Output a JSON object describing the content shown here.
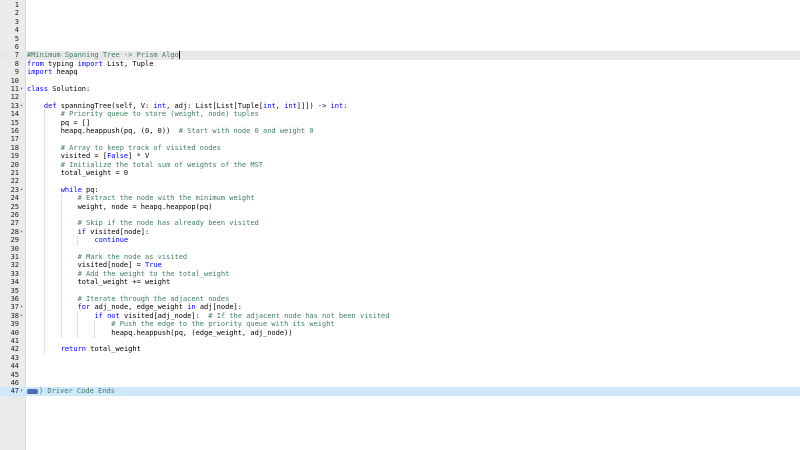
{
  "editor": {
    "lines": [
      {
        "n": "1",
        "text": ""
      },
      {
        "n": "2",
        "text": ""
      },
      {
        "n": "3",
        "text": ""
      },
      {
        "n": "4",
        "text": ""
      },
      {
        "n": "5",
        "text": ""
      },
      {
        "n": "6",
        "text": ""
      },
      {
        "n": "7",
        "text": "#Minimum Spanning Tree -> Prism Algo",
        "type": "comment",
        "active": true
      },
      {
        "n": "8",
        "text": "from typing import List, Tuple"
      },
      {
        "n": "9",
        "text": "import heapq"
      },
      {
        "n": "10",
        "text": ""
      },
      {
        "n": "11",
        "text": "class Solution:",
        "fold": true
      },
      {
        "n": "12",
        "text": ""
      },
      {
        "n": "13",
        "text": "    def spanningTree(self, V: int, adj: List[List[Tuple[int, int]]]) -> int:",
        "fold": true
      },
      {
        "n": "14",
        "text": "        # Priority queue to store (weight, node) tuples",
        "type": "comment"
      },
      {
        "n": "15",
        "text": "        pq = []"
      },
      {
        "n": "16",
        "text": "        heapq.heappush(pq, (0, 0))  # Start with node 0 and weight 0"
      },
      {
        "n": "17",
        "text": ""
      },
      {
        "n": "18",
        "text": "        # Array to keep track of visited nodes",
        "type": "comment"
      },
      {
        "n": "19",
        "text": "        visited = [False] * V"
      },
      {
        "n": "20",
        "text": "        # Initialize the total sum of weights of the MST",
        "type": "comment"
      },
      {
        "n": "21",
        "text": "        total_weight = 0"
      },
      {
        "n": "22",
        "text": ""
      },
      {
        "n": "23",
        "text": "        while pq:",
        "fold": true
      },
      {
        "n": "24",
        "text": "            # Extract the node with the minimum weight",
        "type": "comment"
      },
      {
        "n": "25",
        "text": "            weight, node = heapq.heappop(pq)"
      },
      {
        "n": "26",
        "text": ""
      },
      {
        "n": "27",
        "text": "            # Skip if the node has already been visited",
        "type": "comment"
      },
      {
        "n": "28",
        "text": "            if visited[node]:",
        "fold": true
      },
      {
        "n": "29",
        "text": "                continue"
      },
      {
        "n": "30",
        "text": ""
      },
      {
        "n": "31",
        "text": "            # Mark the node as visited",
        "type": "comment"
      },
      {
        "n": "32",
        "text": "            visited[node] = True"
      },
      {
        "n": "33",
        "text": "            # Add the weight to the total_weight",
        "type": "comment"
      },
      {
        "n": "34",
        "text": "            total_weight += weight"
      },
      {
        "n": "35",
        "text": ""
      },
      {
        "n": "36",
        "text": "            # Iterate through the adjacent nodes",
        "type": "comment"
      },
      {
        "n": "37",
        "text": "            for adj_node, edge_weight in adj[node]:",
        "fold": true
      },
      {
        "n": "38",
        "text": "                if not visited[adj_node]:  # If the adjacent node has not been visited",
        "fold": true
      },
      {
        "n": "39",
        "text": "                    # Push the edge to the priority queue with its weight",
        "type": "comment"
      },
      {
        "n": "40",
        "text": "                    heapq.heappush(pq, (edge_weight, adj_node))"
      },
      {
        "n": "41",
        "text": ""
      },
      {
        "n": "42",
        "text": "        return total_weight"
      },
      {
        "n": "43",
        "text": ""
      },
      {
        "n": "44",
        "text": ""
      },
      {
        "n": "45",
        "text": ""
      },
      {
        "n": "46",
        "text": ""
      },
      {
        "n": "47",
        "text": "} Driver Code Ends",
        "type": "comment",
        "selected": true,
        "fold": true,
        "tag": true
      }
    ]
  },
  "colors": {
    "keyword": "#0000ff",
    "comment": "#3f7f5f",
    "active_line": "#e8e8e8",
    "selected_line": "#cfe8fc",
    "gutter": "#ebebeb"
  }
}
